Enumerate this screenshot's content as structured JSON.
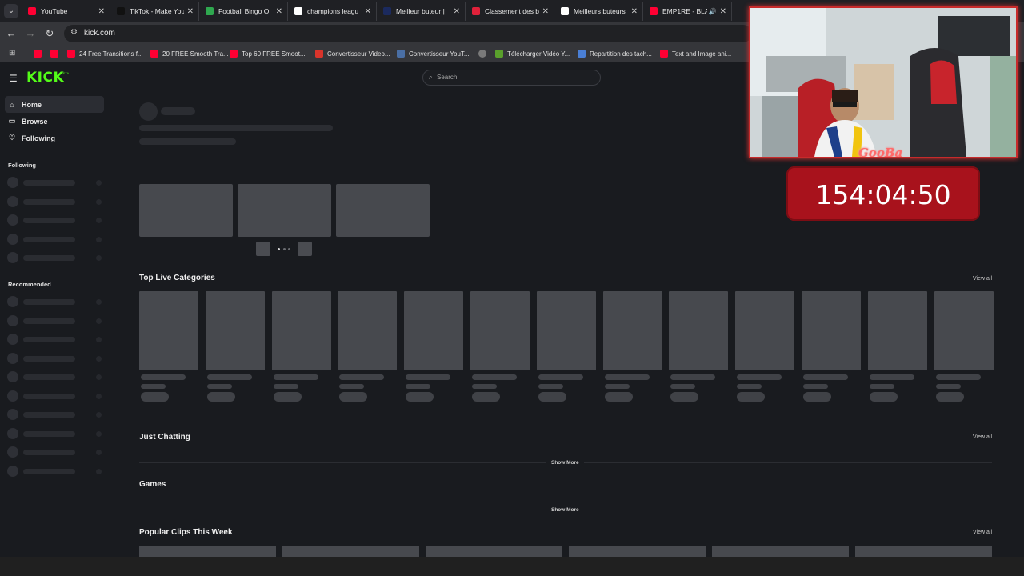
{
  "browser": {
    "tabs": [
      {
        "title": "YouTube",
        "icon": "youtube-icon",
        "color": "#ff0033"
      },
      {
        "title": "TikTok - Make You",
        "icon": "tiktok-icon",
        "color": "#111111"
      },
      {
        "title": "Football Bingo O",
        "icon": "bingo-icon",
        "color": "#2fa84f"
      },
      {
        "title": "champions leagu",
        "icon": "google-icon",
        "color": "#ffffff"
      },
      {
        "title": "Meilleur buteur |",
        "icon": "site-icon",
        "color": "#1b2a5e"
      },
      {
        "title": "Classement des b",
        "icon": "site-icon",
        "color": "#e0213a"
      },
      {
        "title": "Meilleurs buteurs",
        "icon": "wikipedia-icon",
        "color": "#ffffff"
      },
      {
        "title": "EMP1RE - BLA",
        "icon": "youtube-icon",
        "color": "#ff0033"
      }
    ],
    "url": "kick.com",
    "bookmarks": [
      {
        "label": "",
        "icon": "youtube-icon"
      },
      {
        "label": "",
        "icon": "youtube-icon"
      },
      {
        "label": "24 Free Transitions f...",
        "icon": "youtube-icon"
      },
      {
        "label": "20 FREE Smooth Tra...",
        "icon": "youtube-icon"
      },
      {
        "label": "Top 60 FREE Smoot...",
        "icon": "youtube-icon"
      },
      {
        "label": "Convertisseur Video...",
        "icon": "z-icon"
      },
      {
        "label": "Convertisseur YouT...",
        "icon": "converter-icon"
      },
      {
        "label": "",
        "icon": "globe-icon"
      },
      {
        "label": "Télécharger Vidéo Y...",
        "icon": "download-icon"
      },
      {
        "label": "Repartition des tach...",
        "icon": "doc-icon"
      },
      {
        "label": "Text and Image ani...",
        "icon": "youtube-icon"
      }
    ]
  },
  "kick": {
    "logo": "KICK",
    "logo_badge": "BETA",
    "search_placeholder": "Search",
    "nav": [
      {
        "label": "Home",
        "icon": "home-icon"
      },
      {
        "label": "Browse",
        "icon": "browse-icon"
      },
      {
        "label": "Following",
        "icon": "heart-icon"
      }
    ],
    "sidebar_following": "Following",
    "sidebar_recommended": "Recommended",
    "sections": {
      "top_live": "Top Live Categories",
      "just_chatting": "Just Chatting",
      "games": "Games",
      "popular_clips": "Popular Clips This Week"
    },
    "view_all": "View all",
    "show_more": "Show More"
  },
  "overlay": {
    "streamer_name": "GooBa",
    "timer": "154:04:50",
    "accent": "#a8121c"
  },
  "colors": {
    "brand": "#53fc18",
    "background": "#191b1f"
  }
}
